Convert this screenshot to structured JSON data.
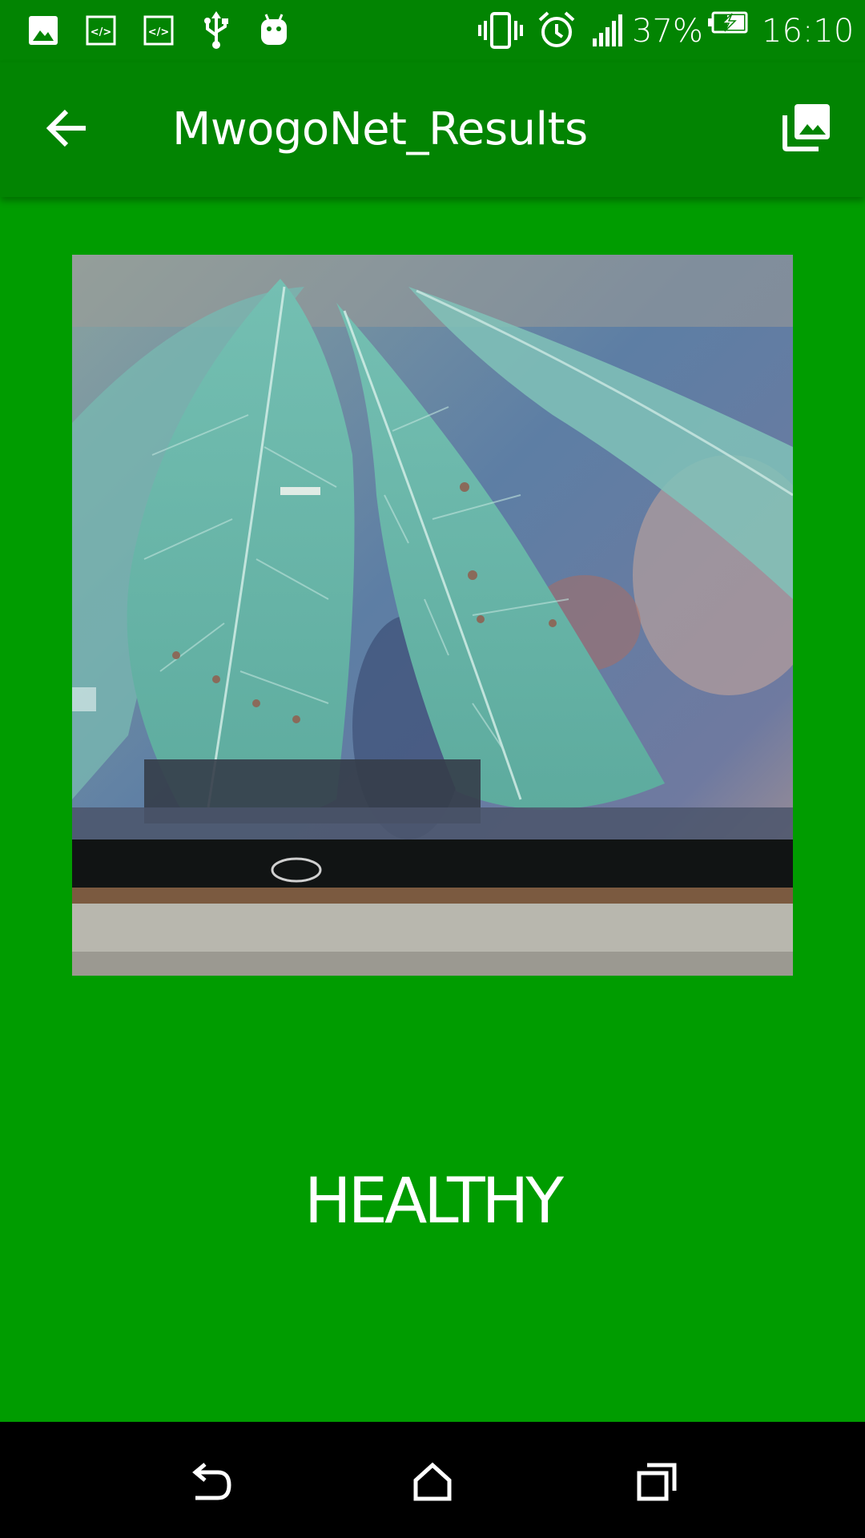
{
  "status_bar": {
    "notification_icons": [
      "image-icon",
      "code-icon",
      "code-icon",
      "usb-icon",
      "android-icon"
    ],
    "system_icons": [
      "vibrate-icon",
      "alarm-icon",
      "signal-icon",
      "battery-charging-icon"
    ],
    "battery_percent": "37%",
    "time": "16:10"
  },
  "app_bar": {
    "title": "MwogoNet_Results",
    "back_icon": "arrow-left-icon",
    "gallery_icon": "photo-library-icon"
  },
  "result": {
    "label": "HEALTHY"
  },
  "nav_bar": {
    "icons": [
      "back-icon",
      "home-icon",
      "recents-icon"
    ]
  },
  "colors": {
    "status_bar": "#028402",
    "app_bar": "#028402",
    "content_background": "#009c00",
    "nav_bar": "#000000",
    "text": "#ffffff"
  }
}
